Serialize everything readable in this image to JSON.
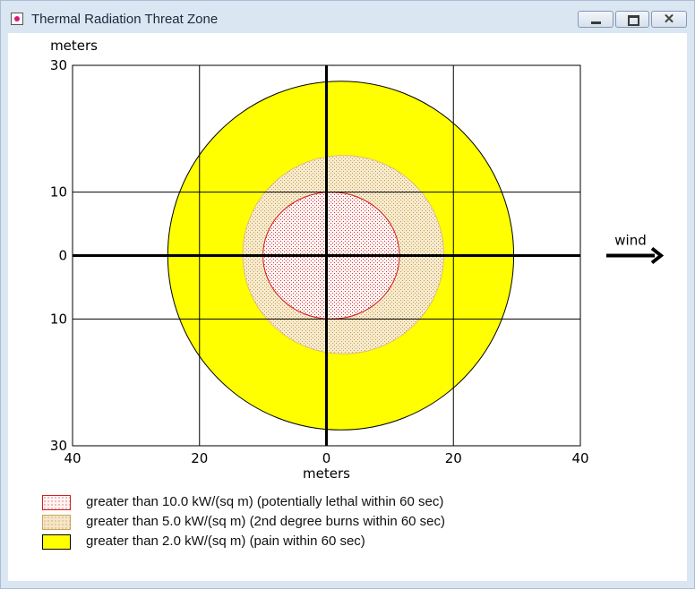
{
  "window": {
    "title": "Thermal Radiation Threat Zone",
    "controls": {
      "minimize": "minimize",
      "maximize": "maximize",
      "close": "✕"
    }
  },
  "chart_data": {
    "type": "area",
    "title": "",
    "xlabel": "meters",
    "ylabel": "meters",
    "xlim": [
      -40,
      40
    ],
    "ylim": [
      -30,
      30
    ],
    "x_ticks": [
      {
        "value": -40,
        "label": "40"
      },
      {
        "value": -20,
        "label": "20"
      },
      {
        "value": 0,
        "label": "0"
      },
      {
        "value": 20,
        "label": "20"
      },
      {
        "value": 40,
        "label": "40"
      }
    ],
    "y_ticks": [
      {
        "value": 30,
        "label": "30"
      },
      {
        "value": 10,
        "label": "10"
      },
      {
        "value": 0,
        "label": "0"
      },
      {
        "value": -10,
        "label": "10"
      },
      {
        "value": -30,
        "label": "30"
      }
    ],
    "grid": true,
    "zones": [
      {
        "label": "greater than 2.0 kW/(sq m) (pain within 60 sec)",
        "threshold_kw_per_sq_m": 2.0,
        "x_min": -25,
        "x_max": 29.5,
        "y_min": -27.5,
        "y_max": 27.5,
        "color": "#ffff00",
        "pattern": "solid"
      },
      {
        "label": "greater than 5.0 kW/(sq m) (2nd degree burns within 60 sec)",
        "threshold_kw_per_sq_m": 5.0,
        "x_min": -13.2,
        "x_max": 18.5,
        "y_min": -15.5,
        "y_max": 15.8,
        "color": "#f4e6c6",
        "pattern": "dotted"
      },
      {
        "label": "greater than 10.0 kW/(sq m) (potentially lethal within 60 sec)",
        "threshold_kw_per_sq_m": 10.0,
        "x_min": -10,
        "x_max": 11.5,
        "y_min": -10,
        "y_max": 10,
        "color": "#fff4f4",
        "pattern": "dotted-red"
      }
    ],
    "wind": {
      "label": "wind",
      "direction": "east"
    }
  },
  "legend": {
    "items": [
      {
        "text": "greater than 10.0 kW/(sq m) (potentially lethal within 60 sec)",
        "fill": "#fff4f4",
        "border": "#d02020",
        "dot": "#d02020"
      },
      {
        "text": "greater than 5.0 kW/(sq m) (2nd degree burns within 60 sec)",
        "fill": "#f4e6c6",
        "border": "#caa45a",
        "dot": "#b88a3a"
      },
      {
        "text": "greater than 2.0 kW/(sq m) (pain within 60 sec)",
        "fill": "#ffff00",
        "border": "#000000",
        "dot": ""
      }
    ]
  }
}
